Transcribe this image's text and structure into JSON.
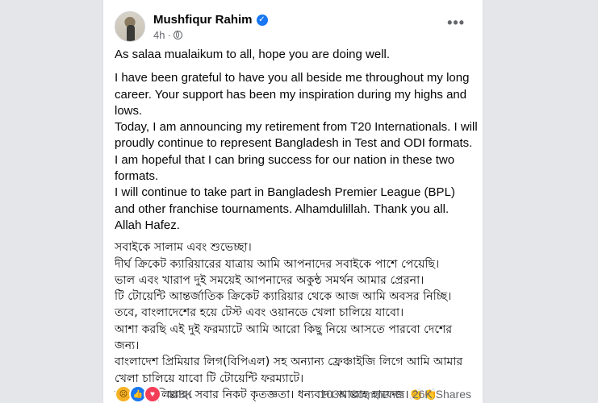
{
  "post": {
    "author": "Mushfiqur Rahim",
    "time": "4h",
    "more_label": "•••",
    "verified_mark": "✓",
    "english": [
      "As salaa mualaikum to all, hope you are doing well.",
      "I have been grateful to have you all beside me throughout my long career. Your support has been my inspiration during my highs and lows.",
      "Today, I am announcing my retirement from T20 Internationals. I will proudly continue to represent Bangladesh in Test and ODI formats. I am hopeful that I can bring success for our nation in these two formats.",
      "I will continue to take part in Bangladesh Premier League (BPL) and other franchise tournaments. Alhamdulillah. Thank you all. Allah Hafez."
    ],
    "bangla": [
      "সবাইকে সালাম এবং শুভেচ্ছা।",
      "দীর্ঘ ক্রিকেট ক্যারিয়ারের যাত্রায় আমি আপনাদের সবাইকে পাশে পেয়েছি।",
      "ভাল এবং খারাপ দুই সময়েই আপনাদের অকুন্ঠ সমর্থন আমার প্রেরনা।",
      "টি টোয়েন্টি আন্তর্জাতিক ক্রিকেট ক্যারিয়ার থেকে আজ আমি অবসর নিচ্ছি। তবে, বাংলাদেশের হয়ে টেস্ট এবং ওয়ানডে খেলা চালিয়ে যাবো।",
      "আশা করছি এই দুই ফরম্যাটে আমি আরো কিছু নিয়ে আসতে পারবো দেশের জন্য।",
      "বাংলাদেশ প্রিমিয়ার লিগ(বিপিএল) সহ অন্যান্য ফ্রেঞ্চাইজি লিগে আমি আমার খেলা চালিয়ে যাবো টি টোয়েন্টি ফরম্যাটে।",
      "আলহামদুলিল্লাহ। সবার নিকট কৃতজ্ঞতা। ধন্যবাদ। আল্লাহ হাফেজ।👏👏"
    ],
    "emoji_line": "👏🤲🤲🤲"
  },
  "stats": {
    "reaction_count": "438K",
    "comments": "103K Comments",
    "shares": "26K Shares"
  },
  "colors": {
    "background": "#e4e6e9",
    "card": "#ffffff",
    "secondary_text": "#65676b",
    "verified": "#1877f2"
  }
}
